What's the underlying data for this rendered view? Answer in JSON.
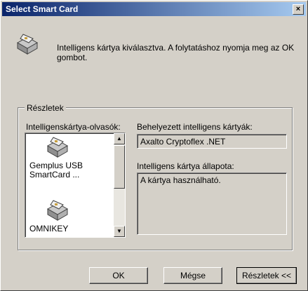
{
  "window": {
    "title": "Select Smart Card",
    "close_glyph": "×"
  },
  "header": {
    "icon": "smart-card-reader-icon",
    "message": "Intelligens kártya kiválasztva. A folytatáshoz nyomja meg az OK gombot."
  },
  "details": {
    "group_label": "Részletek",
    "readers_label": "Intelligenskártya-olvasók:",
    "readers": [
      {
        "label": "Gemplus USB SmartCard ..."
      },
      {
        "label": "OMNIKEY"
      }
    ],
    "inserted_cards_label": "Behelyezett intelligens kártyák:",
    "inserted_card": "Axalto Cryptoflex .NET",
    "status_label": "Intelligens kártya állapota:",
    "status": "A kártya használható."
  },
  "buttons": {
    "ok": "OK",
    "cancel": "Mégse",
    "details": "Részletek <<"
  },
  "colors": {
    "title_start": "#0a246a",
    "title_end": "#a6caf0",
    "face": "#d4d0c8"
  }
}
